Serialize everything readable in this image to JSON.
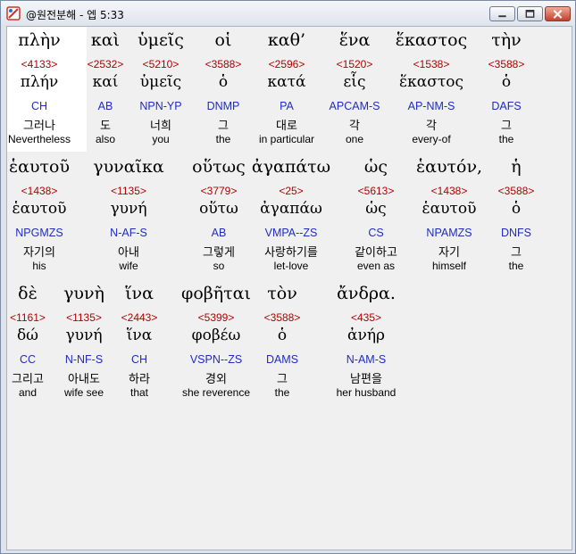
{
  "window": {
    "title": "@원전분해 - 엡 5:33"
  },
  "verse": {
    "rows": [
      {
        "words": [
          {
            "greek": "πλὴν",
            "strongs": "<4133>",
            "lemma": "πλήν",
            "parse": "CH",
            "korean": "그러나",
            "english": "Nevertheless"
          },
          {
            "greek": "καὶ",
            "strongs": "<2532>",
            "lemma": "καί",
            "parse": "AB",
            "korean": "도",
            "english": "also"
          },
          {
            "greek": "ὑμεῖς",
            "strongs": "<5210>",
            "lemma": "ὑμεῖς",
            "parse": "NPN-YP",
            "korean": "너희",
            "english": "you"
          },
          {
            "greek": "οἱ",
            "strongs": "<3588>",
            "lemma": "ὁ",
            "parse": "DNMP",
            "korean": "그",
            "english": "the"
          },
          {
            "greek": "καθ’",
            "strongs": "<2596>",
            "lemma": "κατά",
            "parse": "PA",
            "korean": "대로",
            "english": "in particular"
          },
          {
            "greek": "ἕνα",
            "strongs": "<1520>",
            "lemma": "εἷς",
            "parse": "APCAM-S",
            "korean": "각",
            "english": "one"
          },
          {
            "greek": "ἕκαστος",
            "strongs": "<1538>",
            "lemma": "ἕκαστος",
            "parse": "AP-NM-S",
            "korean": "각",
            "english": "every-of"
          },
          {
            "greek": "τὴν",
            "strongs": "<3588>",
            "lemma": "ὁ",
            "parse": "DAFS",
            "korean": "그",
            "english": "the"
          }
        ]
      },
      {
        "words": [
          {
            "greek": "ἑαυτοῦ",
            "strongs": "<1438>",
            "lemma": "ἑαυτοῦ",
            "parse": "NPGMZS",
            "korean": "자기의",
            "english": "his"
          },
          {
            "greek": "γυναῖκα",
            "strongs": "<1135>",
            "lemma": "γυνή",
            "parse": "N-AF-S",
            "korean": "아내",
            "english": "wife"
          },
          {
            "greek": "οὕτως",
            "strongs": "<3779>",
            "lemma": "οὕτω",
            "parse": "AB",
            "korean": "그렇게",
            "english": "so"
          },
          {
            "greek": "ἀγαπάτω",
            "strongs": "<25>",
            "lemma": "ἀγαπάω",
            "parse": "VMPA--ZS",
            "korean": "사랑하기를",
            "english": "let-love"
          },
          {
            "greek": "ὡς",
            "strongs": "<5613>",
            "lemma": "ὡς",
            "parse": "CS",
            "korean": "같이하고",
            "english": "even as"
          },
          {
            "greek": "ἑαυτόν,",
            "strongs": "<1438>",
            "lemma": "ἑαυτοῦ",
            "parse": "NPAMZS",
            "korean": "자기",
            "english": "himself"
          },
          {
            "greek": "ἡ",
            "strongs": "<3588>",
            "lemma": "ὁ",
            "parse": "DNFS",
            "korean": "그",
            "english": "the"
          }
        ]
      },
      {
        "words": [
          {
            "greek": "δὲ",
            "strongs": "<1161>",
            "lemma": "δώ",
            "parse": "CC",
            "korean": "그리고",
            "english": "and"
          },
          {
            "greek": "γυνὴ",
            "strongs": "<1135>",
            "lemma": "γυνή",
            "parse": "N-NF-S",
            "korean": "아내도",
            "english": "wife see"
          },
          {
            "greek": "ἵνα",
            "strongs": "<2443>",
            "lemma": "ἵνα",
            "parse": "CH",
            "korean": "하라",
            "english": "that"
          },
          {
            "greek": "φοβῆται",
            "strongs": "<5399>",
            "lemma": "φοβέω",
            "parse": "VSPN--ZS",
            "korean": "경외",
            "english": "she reverence"
          },
          {
            "greek": "τὸν",
            "strongs": "<3588>",
            "lemma": "ὁ",
            "parse": "DAMS",
            "korean": "그",
            "english": "the"
          },
          {
            "greek": "ἄνδρα.",
            "strongs": "<435>",
            "lemma": "ἀνήρ",
            "parse": "N-AM-S",
            "korean": "남편을",
            "english": "her husband"
          }
        ]
      }
    ]
  },
  "colors": {
    "strongs": "#b00000",
    "parse": "#1f2dbf",
    "highlight": "#ffffff"
  },
  "icons": {
    "app": "app-logo-icon",
    "minimize": "minimize-icon",
    "maximize": "maximize-icon",
    "close": "close-icon"
  }
}
